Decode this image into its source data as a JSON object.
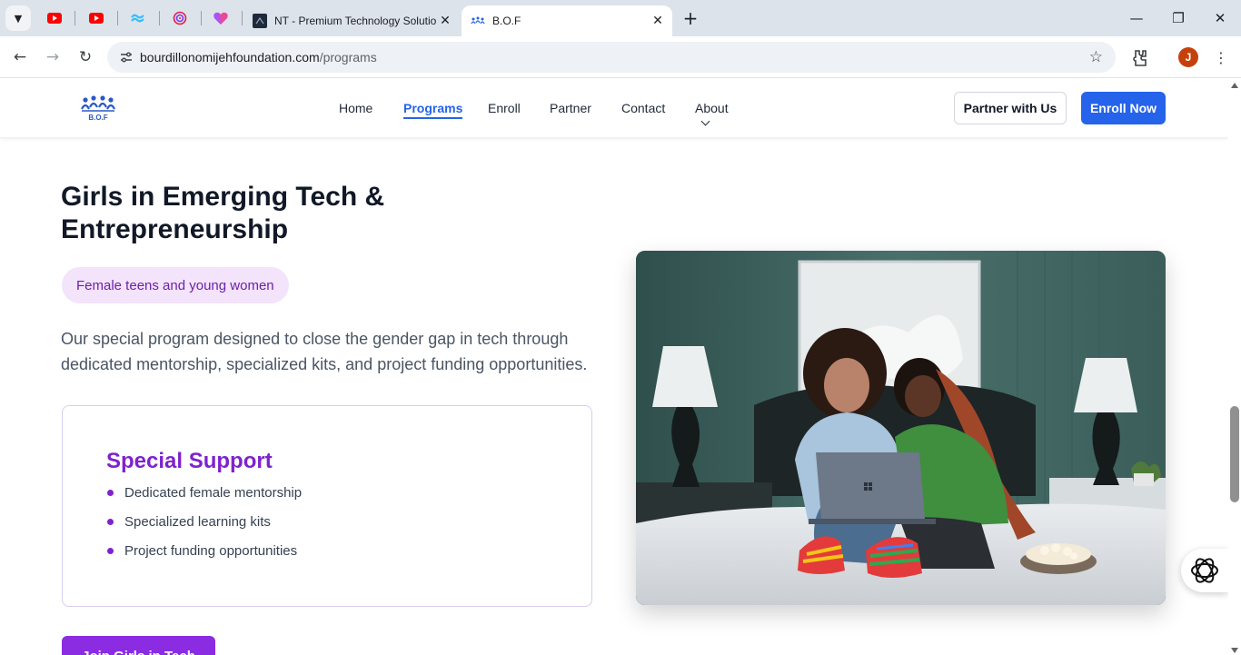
{
  "browser": {
    "tabs": [
      {
        "title": "NT - Premium Technology Solutions",
        "active": false
      },
      {
        "title": "B.O.F",
        "active": true
      }
    ],
    "url_host": "bourdillonomijehfoundation.com",
    "url_path": "/programs",
    "profile_initial": "J",
    "icons": [
      "tab-search-icon",
      "youtube-icon",
      "tailwind-icon",
      "swirl-icon",
      "heart-icon",
      "close-icon",
      "new-tab-icon",
      "minimize-icon",
      "restore-icon",
      "back-icon",
      "forward-icon",
      "reload-icon",
      "site-info-icon",
      "star-icon",
      "extensions-icon",
      "menu-icon"
    ]
  },
  "site": {
    "logo_text": "B.O.F",
    "nav": [
      {
        "label": "Home"
      },
      {
        "label": "Programs",
        "active": true
      },
      {
        "label": "Enroll"
      },
      {
        "label": "Partner"
      },
      {
        "label": "Contact"
      },
      {
        "label": "About"
      }
    ],
    "partner_button": "Partner with Us",
    "enroll_button": "Enroll Now"
  },
  "program": {
    "title": "Girls in Emerging Tech & Entrepreneurship",
    "audience": "Female teens and young women",
    "description": "Our special program designed to close the gender gap in tech through dedicated mentorship, specialized kits, and project funding opportunities.",
    "support_title": "Special Support",
    "support_items": [
      "Dedicated female mentorship",
      "Specialized learning kits",
      "Project funding opportunities"
    ],
    "cta_label": "Join Girls in Tech"
  },
  "colors": {
    "primary_blue": "#2563eb",
    "accent_purple": "#7e22ce",
    "pill_bg": "#f3e3fb"
  }
}
